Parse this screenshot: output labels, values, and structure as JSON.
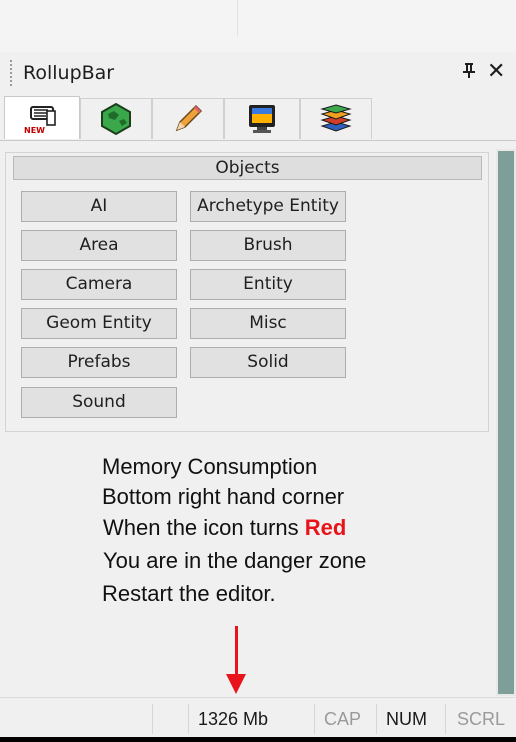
{
  "window": {
    "title": "RollupBar",
    "pin_glyph": "⊥",
    "close_glyph": "✕"
  },
  "tabs": [
    {
      "icon": "new-object-hand-icon",
      "active": true
    },
    {
      "icon": "terrain-globe-icon",
      "active": false
    },
    {
      "icon": "pencil-icon",
      "active": false
    },
    {
      "icon": "monitor-display-icon",
      "active": false
    },
    {
      "icon": "layers-stack-icon",
      "active": false
    }
  ],
  "objects": {
    "header": "Objects",
    "buttons": [
      "AI",
      "Archetype Entity",
      "Area",
      "Brush",
      "Camera",
      "Entity",
      "Geom Entity",
      "Misc",
      "Prefabs",
      "Solid",
      "Sound"
    ]
  },
  "annotation": {
    "line1": "Memory Consumption",
    "line2": "Bottom right hand corner",
    "line3_prefix": "When the icon turns ",
    "line3_red": "Red",
    "line4": "You are in the danger zone",
    "line5": "Restart the editor."
  },
  "statusbar": {
    "memory": "1326 Mb",
    "cap": "CAP",
    "num": "NUM",
    "scrl": "SCRL"
  },
  "colors": {
    "highlight_red": "#e8141b",
    "scroll_thumb": "#7e9e9a"
  }
}
